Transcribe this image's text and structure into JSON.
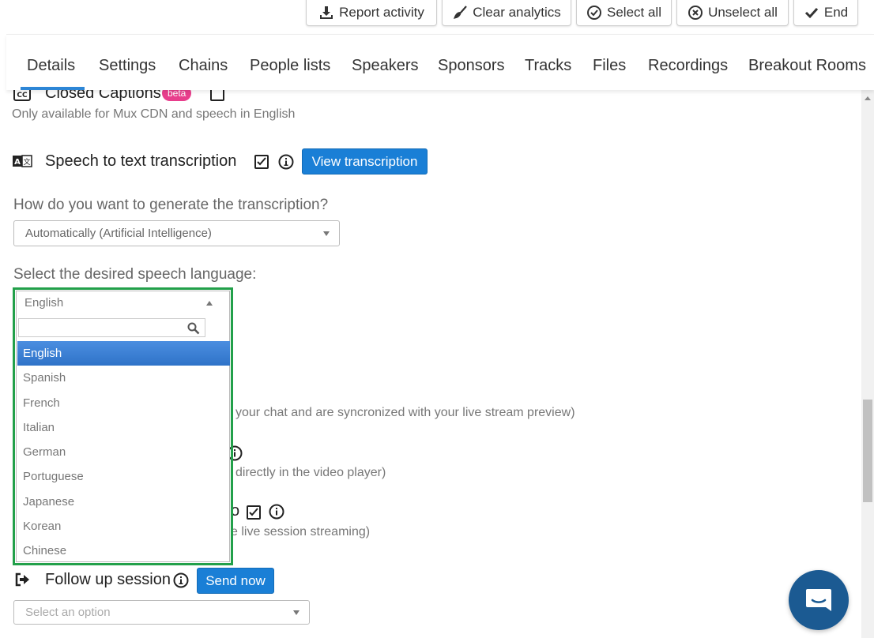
{
  "toolbar": {
    "report_activity": "Report activity",
    "clear_analytics": "Clear analytics",
    "select_all": "Select all",
    "unselect_all": "Unselect all",
    "end": "End"
  },
  "tabs": [
    {
      "label": "Details",
      "active": true
    },
    {
      "label": "Settings"
    },
    {
      "label": "Chains"
    },
    {
      "label": "People lists"
    },
    {
      "label": "Speakers"
    },
    {
      "label": "Sponsors"
    },
    {
      "label": "Tracks"
    },
    {
      "label": "Files"
    },
    {
      "label": "Recordings"
    },
    {
      "label": "Breakout Rooms"
    }
  ],
  "closed_captions": {
    "label": "Closed Captions",
    "badge": "beta",
    "note": "Only available for Mux CDN and speech in English"
  },
  "speech_to_text": {
    "label": "Speech to text transcription",
    "view_button": "View transcription"
  },
  "transcription_method": {
    "question": "How do you want to generate the transcription?",
    "selected": "Automatically (Artificial Intelligence)"
  },
  "speech_language": {
    "question": "Select the desired speech language:",
    "selected": "English",
    "options": [
      "English",
      "Spanish",
      "French",
      "Italian",
      "German",
      "Portuguese",
      "Japanese",
      "Korean",
      "Chinese"
    ]
  },
  "partial_texts": {
    "line1": "your chat and are syncronized with your live stream preview)",
    "line2": "directly in the video player)",
    "line3": "e live session streaming)",
    "fragment_o": "o"
  },
  "follow_up": {
    "label": "Follow up session",
    "send_button": "Send now",
    "placeholder": "Select an option"
  },
  "colors": {
    "accent": "#1a7fd6",
    "highlight_border": "#22a04a",
    "beta_badge": "#e83e8c",
    "chat_bubble": "#1b5a92"
  }
}
